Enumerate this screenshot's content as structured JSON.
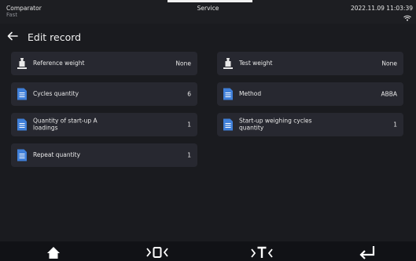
{
  "status_bar": {
    "mode": "Comparator",
    "profile": "Fast",
    "user": "Service",
    "datetime": "2022.11.09 11:03:39"
  },
  "header": {
    "title": "Edit record"
  },
  "fields": [
    {
      "label": "Reference weight",
      "value": "None",
      "icon": "weight-icon"
    },
    {
      "label": "Test weight",
      "value": "None",
      "icon": "weight-icon"
    },
    {
      "label": "Cycles quantity",
      "value": "6",
      "icon": "document-icon"
    },
    {
      "label": "Method",
      "value": "ABBA",
      "icon": "document-icon"
    },
    {
      "label": "Quantity of start-up A loadings",
      "value": "1",
      "icon": "document-icon"
    },
    {
      "label": "Start-up weighing cycles quantity",
      "value": "1",
      "icon": "document-icon"
    },
    {
      "label": "Repeat quantity",
      "value": "1",
      "icon": "document-icon"
    }
  ],
  "bottom_bar": {
    "buttons": [
      "home-icon",
      "zero-icon",
      "tare-icon",
      "enter-icon"
    ]
  },
  "colors": {
    "background": "#1a1b1f",
    "card": "#272830",
    "accent_blue": "#3f7fd9"
  }
}
